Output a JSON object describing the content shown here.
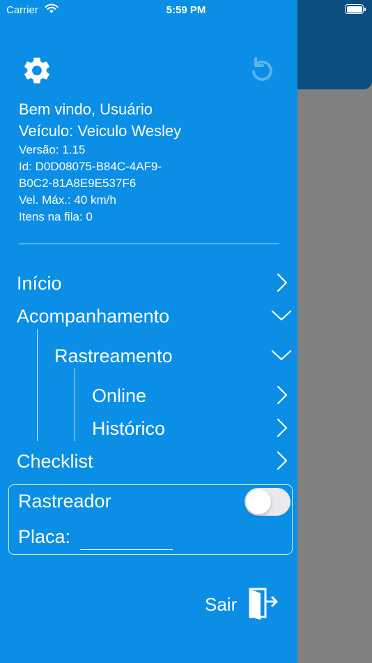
{
  "status_bar": {
    "carrier": "Carrier",
    "time": "5:59 PM"
  },
  "icons": {
    "settings": "gear-icon",
    "refresh": "refresh-icon",
    "logout": "logout-door-icon",
    "wifi": "wifi-icon",
    "battery": "battery-icon",
    "chevron_right": "chevron-right-icon",
    "chevron_down": "chevron-down-icon"
  },
  "info": {
    "welcome": "Bem vindo, Usuário",
    "vehicle": "Veículo: Veiculo Wesley",
    "version": "Versão: 1.15",
    "id_line1": "Id: D0D08075-B84C-4AF9-",
    "id_line2": "B0C2-81A8E9E537F6",
    "max_speed": "Vel. Máx.: 40 km/h",
    "queue": "Itens na fila: 0"
  },
  "menu": {
    "inicio": "Início",
    "acompanhamento": "Acompanhamento",
    "rastreamento": "Rastreamento",
    "online": "Online",
    "historico": "Histórico",
    "checklist": "Checklist"
  },
  "tracker": {
    "label": "Rastreador",
    "enabled": false,
    "plate_label": "Placa:",
    "plate_value": ""
  },
  "logout": {
    "label": "Sair"
  },
  "colors": {
    "drawer_background": "#0a8ee6",
    "dim_overlay": "#808080",
    "header_behind": "#0a4e82",
    "text": "#ffffff"
  }
}
